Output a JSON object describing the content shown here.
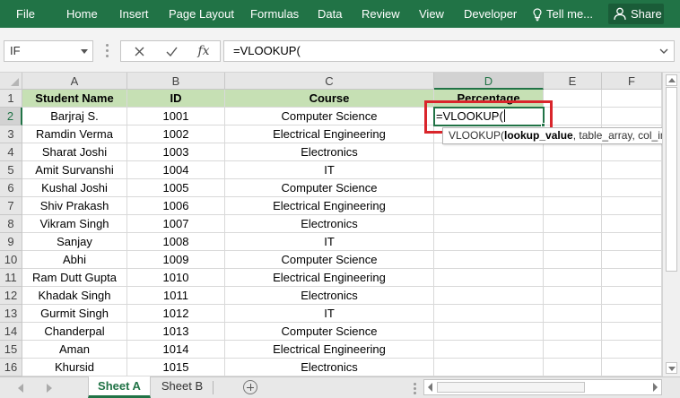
{
  "ribbon": {
    "menu": [
      "File",
      "Home",
      "Insert",
      "Page Layout",
      "Formulas",
      "Data",
      "Review",
      "View",
      "Developer"
    ],
    "tell_me": "Tell me...",
    "share": "Share",
    "color": "#217346"
  },
  "formula_bar": {
    "name_box": "IF",
    "cancel_icon": "x-icon",
    "enter_icon": "checkmark-icon",
    "insert_function": "fx",
    "formula": "=VLOOKUP("
  },
  "grid": {
    "columns": [
      "A",
      "B",
      "C",
      "D",
      "E",
      "F"
    ],
    "selected_column": "D",
    "selected_row": "2",
    "header_fill": "#c6e0b4",
    "headers": [
      "Student Name",
      "ID",
      "Course",
      "Percentage"
    ],
    "rows": [
      {
        "num": "1"
      },
      {
        "num": "2",
        "name": "Barjraj S.",
        "id": "1001",
        "course": "Computer Science"
      },
      {
        "num": "3",
        "name": "Ramdin Verma",
        "id": "1002",
        "course": "Electrical Engineering"
      },
      {
        "num": "4",
        "name": "Sharat Joshi",
        "id": "1003",
        "course": "Electronics"
      },
      {
        "num": "5",
        "name": "Amit Survanshi",
        "id": "1004",
        "course": "IT"
      },
      {
        "num": "6",
        "name": "Kushal Joshi",
        "id": "1005",
        "course": "Computer Science"
      },
      {
        "num": "7",
        "name": "Shiv Prakash",
        "id": "1006",
        "course": "Electrical Engineering"
      },
      {
        "num": "8",
        "name": "Vikram Singh",
        "id": "1007",
        "course": "Electronics"
      },
      {
        "num": "9",
        "name": "Sanjay",
        "id": "1008",
        "course": "IT"
      },
      {
        "num": "10",
        "name": "Abhi",
        "id": "1009",
        "course": "Computer Science"
      },
      {
        "num": "11",
        "name": "Ram Dutt Gupta",
        "id": "1010",
        "course": "Electrical Engineering"
      },
      {
        "num": "12",
        "name": "Khadak Singh",
        "id": "1011",
        "course": "Electronics"
      },
      {
        "num": "13",
        "name": "Gurmit Singh",
        "id": "1012",
        "course": "IT"
      },
      {
        "num": "14",
        "name": "Chanderpal",
        "id": "1013",
        "course": "Computer Science"
      },
      {
        "num": "15",
        "name": "Aman",
        "id": "1014",
        "course": "Electrical Engineering"
      },
      {
        "num": "16",
        "name": "Khursid",
        "id": "1015",
        "course": "Electronics"
      }
    ],
    "active_cell_value": "=VLOOKUP(",
    "tooltip": {
      "func": "VLOOKUP(",
      "arg_bold": "lookup_value",
      "rest": ", table_array, col_index_num, [range_lookup])"
    },
    "highlight_color": "#d9252b"
  },
  "sheets": {
    "tabs": [
      "Sheet A",
      "Sheet B"
    ],
    "active": "Sheet A"
  }
}
